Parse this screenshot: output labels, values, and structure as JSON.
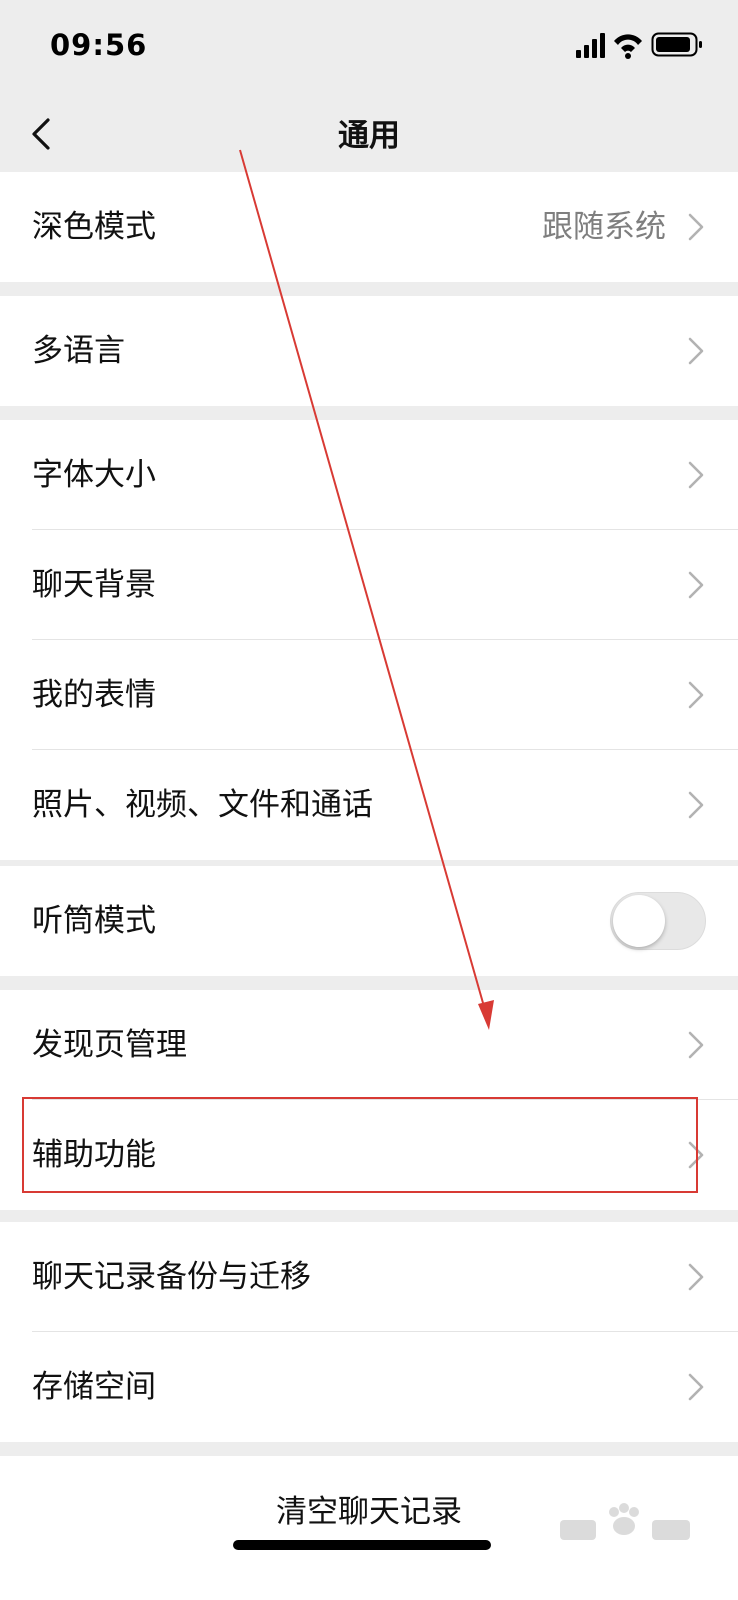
{
  "status": {
    "time": "09:56"
  },
  "nav": {
    "title": "通用"
  },
  "groups": {
    "g1": {
      "dark_mode": {
        "label": "深色模式",
        "value": "跟随系统"
      }
    },
    "g2": {
      "language": {
        "label": "多语言"
      }
    },
    "g3": {
      "font_size": {
        "label": "字体大小"
      },
      "chat_background": {
        "label": "聊天背景"
      },
      "my_stickers": {
        "label": "我的表情"
      },
      "media": {
        "label": "照片、视频、文件和通话"
      }
    },
    "g4": {
      "earpiece_mode": {
        "label": "听筒模式",
        "enabled": false
      }
    },
    "g5": {
      "discover": {
        "label": "发现页管理"
      },
      "accessibility": {
        "label": "辅助功能"
      }
    },
    "g6": {
      "backup": {
        "label": "聊天记录备份与迁移"
      },
      "storage": {
        "label": "存储空间"
      }
    }
  },
  "bottom": {
    "clear_history": "清空聊天记录"
  },
  "annotation": {
    "color": "#d83a34"
  }
}
